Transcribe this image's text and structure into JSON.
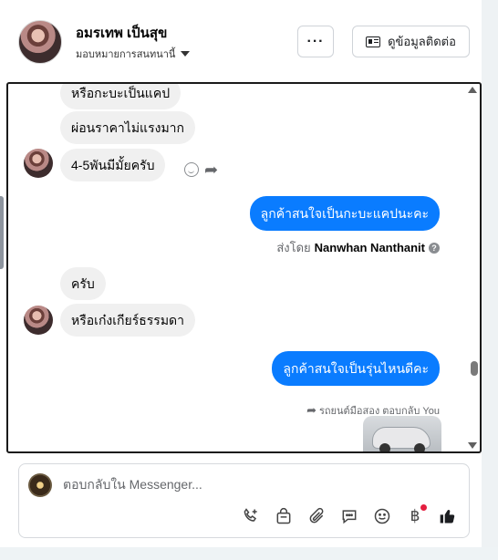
{
  "header": {
    "contact_name": "อมรเทพ เป็นสุข",
    "assign_label": "มอบหมายการสนทนานี้",
    "more_label": "···",
    "contact_info_label": "ดูข้อมูลติดต่อ"
  },
  "messages": {
    "in_1": "หรือกะบะเป็นแคป",
    "in_2": "ผ่อนราคาไม่แรงมาก",
    "in_3": "4-5พันมีมั้ยครับ",
    "out_1": "ลูกค้าสนใจเป็นกะบะแคปนะคะ",
    "sent_by_prefix": "ส่งโดย",
    "sent_by_name": "Nanwhan Nanthanit",
    "in_4": "ครับ",
    "in_5": "หรือเก๋งเกียร์ธรรมดา",
    "out_2": "ลูกค้าสนใจเป็นรุ่นไหนดีคะ",
    "reply_note": "รถยนต์มือสอง ตอบกลับ You"
  },
  "composer": {
    "placeholder": "ตอบกลับใน Messenger..."
  },
  "toolbar_icons": [
    "call-add-icon",
    "shopping-bag-icon",
    "paperclip-icon",
    "chat-bubble-icon",
    "emoji-icon",
    "baht-icon",
    "thumbs-up-icon"
  ],
  "colors": {
    "accent": "#0a7cff",
    "incoming_bubble": "#f0f0f0",
    "notification_dot": "#e41e3f"
  }
}
